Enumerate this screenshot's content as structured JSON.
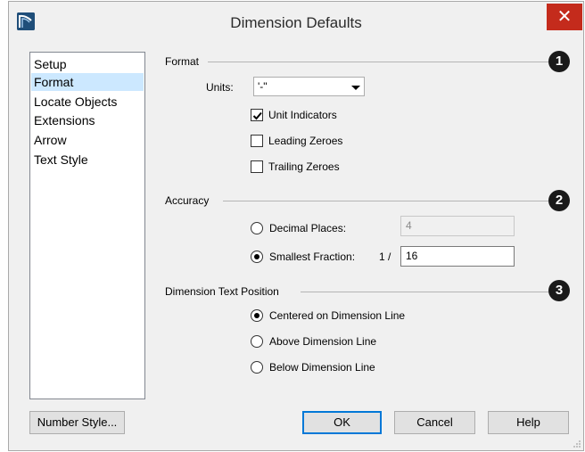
{
  "window": {
    "title": "Dimension Defaults",
    "close_glyph": "✕",
    "app_icon": "app-logo-icon",
    "close_color": "#c42b1c"
  },
  "sidebar": {
    "items": [
      {
        "label": "Setup",
        "selected": false
      },
      {
        "label": "Format",
        "selected": true
      },
      {
        "label": "Locate Objects",
        "selected": false
      },
      {
        "label": "Extensions",
        "selected": false
      },
      {
        "label": "Arrow",
        "selected": false
      },
      {
        "label": "Text Style",
        "selected": false
      }
    ],
    "selected_color": "#cce8ff"
  },
  "format": {
    "group_label": "Format",
    "badge": "1",
    "units_label": "Units:",
    "units_value": "'-\"",
    "unit_indicators_label": "Unit Indicators",
    "unit_indicators_checked": true,
    "leading_zeroes_label": "Leading Zeroes",
    "leading_zeroes_checked": false,
    "trailing_zeroes_label": "Trailing Zeroes",
    "trailing_zeroes_checked": false
  },
  "accuracy": {
    "group_label": "Accuracy",
    "badge": "2",
    "decimal_places_label": "Decimal Places:",
    "decimal_places_value": "4",
    "decimal_places_selected": false,
    "smallest_fraction_label": "Smallest Fraction:",
    "fraction_prefix": "1 /",
    "smallest_fraction_value": "16",
    "smallest_fraction_selected": true
  },
  "text_position": {
    "group_label": "Dimension Text Position",
    "badge": "3",
    "options": [
      {
        "label": "Centered on Dimension Line",
        "selected": true
      },
      {
        "label": "Above Dimension Line",
        "selected": false
      },
      {
        "label": "Below Dimension Line",
        "selected": false
      }
    ]
  },
  "buttons": {
    "number_style": "Number Style...",
    "ok": "OK",
    "cancel": "Cancel",
    "help": "Help",
    "default_border_color": "#0078d7"
  }
}
